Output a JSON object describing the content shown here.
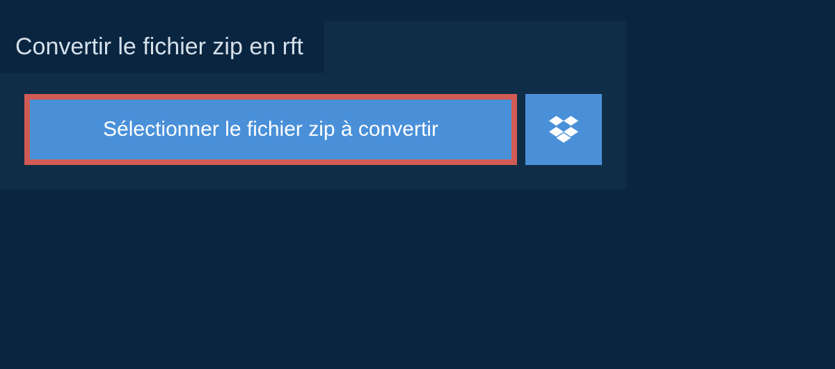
{
  "page": {
    "title": "Convertir le fichier zip en rft"
  },
  "actions": {
    "select_file_label": "Sélectionner le fichier zip à convertir"
  },
  "colors": {
    "background": "#0a2540",
    "panel": "#0f2d47",
    "button": "#4a90d9",
    "highlight_border": "#d15b55",
    "text_light": "#d5e0ea"
  }
}
